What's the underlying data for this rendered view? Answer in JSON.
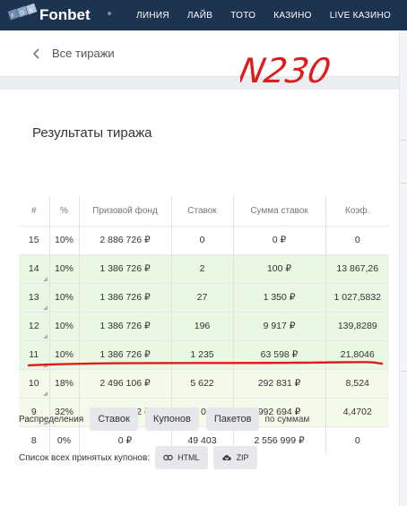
{
  "nav": {
    "brand": "Fonbet",
    "items": [
      "ЛИНИЯ",
      "ЛАЙВ",
      "ТОТО",
      "КАЗИНО",
      "LIVE КАЗИНО"
    ]
  },
  "back": {
    "label": "Все тиражи"
  },
  "annotation": {
    "handwritten": "N230",
    "color": "#e01b1b"
  },
  "page": {
    "title": "Результаты тиража"
  },
  "table": {
    "headers": [
      "#",
      "%",
      "Призовой фонд",
      "Ставок",
      "Сумма ставок",
      "Коэф."
    ],
    "rows": [
      {
        "num": "15",
        "pct": "10%",
        "fund": "2 886 726 ₽",
        "bets": "0",
        "sum": "0 ₽",
        "coef": "0"
      },
      {
        "num": "14",
        "pct": "10%",
        "fund": "1 386 726 ₽",
        "bets": "2",
        "sum": "100 ₽",
        "coef": "13 867,26"
      },
      {
        "num": "13",
        "pct": "10%",
        "fund": "1 386 726 ₽",
        "bets": "27",
        "sum": "1 350 ₽",
        "coef": "1 027,5832"
      },
      {
        "num": "12",
        "pct": "10%",
        "fund": "1 386 726 ₽",
        "bets": "196",
        "sum": "9 917 ₽",
        "coef": "139,8289"
      },
      {
        "num": "11",
        "pct": "10%",
        "fund": "1 386 726 ₽",
        "bets": "1 235",
        "sum": "63 598 ₽",
        "coef": "21,8046"
      },
      {
        "num": "10",
        "pct": "18%",
        "fund": "2 496 106 ₽",
        "bets": "5 622",
        "sum": "292 831 ₽",
        "coef": "8,524"
      },
      {
        "num": "9",
        "pct": "32%",
        "fund": "4 437 522 ₽",
        "bets": "19 069",
        "sum": "992 694 ₽",
        "coef": "4,4702"
      },
      {
        "num": "8",
        "pct": "0%",
        "fund": "0 ₽",
        "bets": "49 403",
        "sum": "2 556 999 ₽",
        "coef": "0"
      }
    ]
  },
  "distribution": {
    "label": "Распределения",
    "buttons": [
      "Ставок",
      "Купонов",
      "Пакетов"
    ],
    "suffix": "по суммам"
  },
  "coupons": {
    "label": "Список всех принятых купонов:",
    "html_button": "HTML",
    "zip_button": "ZIP"
  },
  "colors": {
    "nav_bg": "#1d3450",
    "row_green": "#eaf7e2",
    "row_yellow": "#f5f9ea",
    "highlight": "#e01b1b"
  }
}
